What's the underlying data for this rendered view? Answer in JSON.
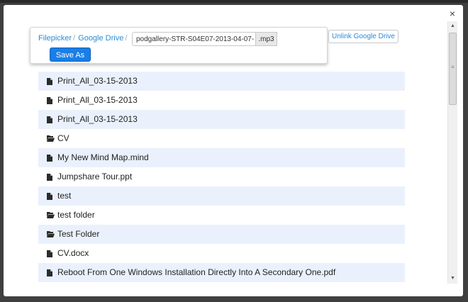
{
  "modal": {
    "close_symbol": "×"
  },
  "toolbar": {
    "breadcrumbs": [
      "Filepicker",
      "Google Drive"
    ],
    "separator": "/",
    "filename_value": "podgallery-STR-S04E07-2013-04-07-",
    "extension": ".mp3",
    "save_label": "Save As"
  },
  "unlink_label": "Unlink Google Drive",
  "files": [
    {
      "name": "Print_All_03-15-2013",
      "icon": "file-icon"
    },
    {
      "name": "Print_All_03-15-2013",
      "icon": "file-icon"
    },
    {
      "name": "Print_All_03-15-2013",
      "icon": "file-icon"
    },
    {
      "name": "CV",
      "icon": "folder-open-icon"
    },
    {
      "name": "My New Mind Map.mind",
      "icon": "file-icon"
    },
    {
      "name": "Jumpshare Tour.ppt",
      "icon": "file-icon"
    },
    {
      "name": "test",
      "icon": "file-icon"
    },
    {
      "name": "test folder",
      "icon": "folder-open-icon"
    },
    {
      "name": "Test Folder",
      "icon": "folder-open-icon"
    },
    {
      "name": "CV.docx",
      "icon": "file-icon"
    },
    {
      "name": "Reboot From One Windows Installation Directly Into A Secondary One.pdf",
      "icon": "file-icon"
    }
  ],
  "scrollbar": {
    "up_arrow": "▲",
    "down_arrow": "▼"
  },
  "colors": {
    "accent": "#1a7ee6",
    "link": "#2a8bd6",
    "row_alt": "#eaf1fc"
  }
}
